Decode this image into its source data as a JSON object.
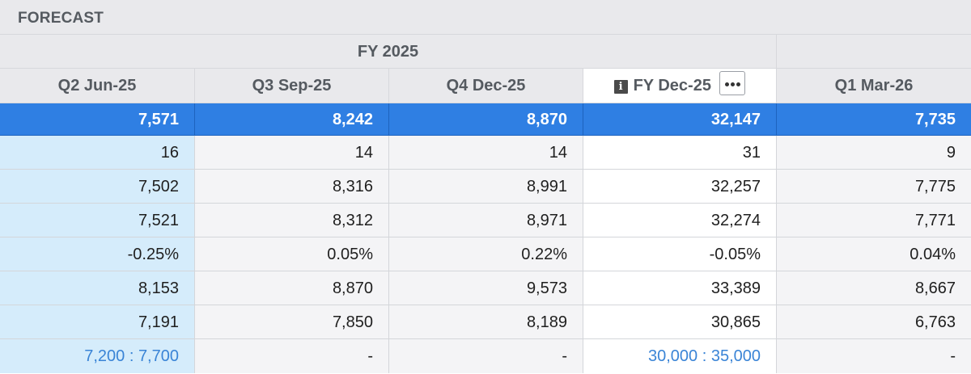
{
  "section": {
    "title": "FORECAST"
  },
  "group": {
    "fiscal_year_label": "FY 2025"
  },
  "columns": [
    {
      "label": "Q2 Jun-25"
    },
    {
      "label": "Q3 Sep-25"
    },
    {
      "label": "Q4 Dec-25"
    },
    {
      "label": "FY Dec-25",
      "info_icon": "info-icon",
      "menu_icon": "more-horizontal-icon"
    },
    {
      "label": "Q1 Mar-26"
    }
  ],
  "rows": [
    {
      "cells": [
        "7,571",
        "8,242",
        "8,870",
        "32,147",
        "7,735"
      ]
    },
    {
      "cells": [
        "16",
        "14",
        "14",
        "31",
        "9"
      ]
    },
    {
      "cells": [
        "7,502",
        "8,316",
        "8,991",
        "32,257",
        "7,775"
      ]
    },
    {
      "cells": [
        "7,521",
        "8,312",
        "8,971",
        "32,274",
        "7,771"
      ]
    },
    {
      "cells": [
        "-0.25%",
        "0.05%",
        "0.22%",
        "-0.05%",
        "0.04%"
      ]
    },
    {
      "cells": [
        "8,153",
        "8,870",
        "9,573",
        "33,389",
        "8,667"
      ]
    },
    {
      "cells": [
        "7,191",
        "7,850",
        "8,189",
        "30,865",
        "6,763"
      ]
    },
    {
      "cells": [
        "7,200 : 7,700",
        "-",
        "-",
        "30,000 : 35,000",
        "-"
      ]
    }
  ],
  "colors": {
    "highlight_row": "#2f7fe3",
    "first_column": "#d5ecfb",
    "range_text": "#3a84d6"
  }
}
